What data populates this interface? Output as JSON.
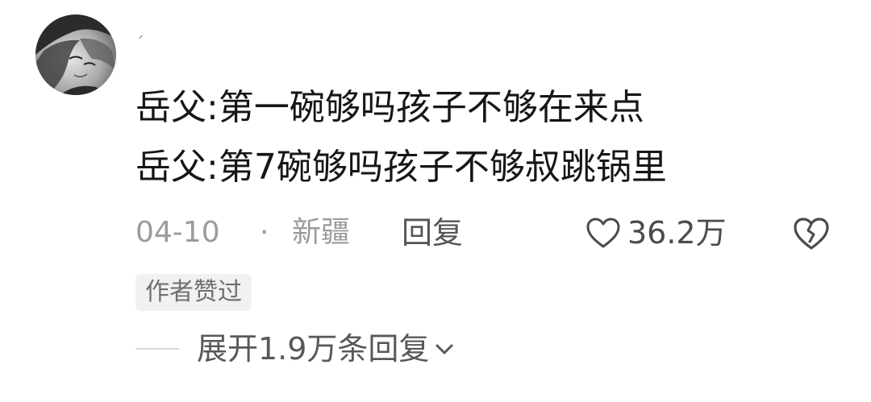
{
  "comment": {
    "username": "ˊ",
    "lines": [
      "岳父:第一碗够吗孩子不够在来点",
      "岳父:第7碗够吗孩子不够叔跳锅里"
    ],
    "date": "04-10",
    "separator": "·",
    "location": "新疆",
    "reply_label": "回复",
    "like_count": "36.2万",
    "author_badge": "作者赞过",
    "expand_replies_label": "展开1.9万条回复"
  },
  "colors": {
    "text_primary": "#161616",
    "text_secondary": "#9b9b9b",
    "badge_background": "#f1f1f1"
  },
  "icons": {
    "avatar": "user-avatar",
    "like": "heart-outline-icon",
    "dislike": "broken-heart-icon",
    "expand": "chevron-down-icon"
  }
}
